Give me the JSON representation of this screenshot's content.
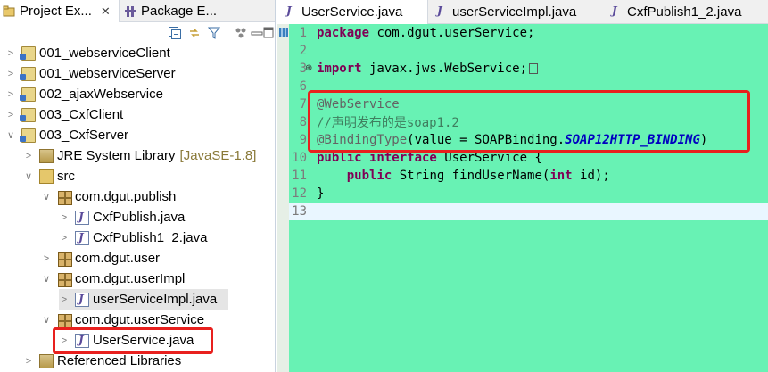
{
  "left_tabs": [
    {
      "label": "Project Ex...",
      "active": true,
      "icon": "project-explorer-icon"
    },
    {
      "label": "Package E...",
      "active": false,
      "icon": "package-explorer-icon"
    }
  ],
  "toolbar_icons": [
    "collapse-all-icon",
    "link-with-editor-icon",
    "filter-icon",
    "view-menu-icon",
    "minimize-icon",
    "maximize-icon"
  ],
  "tree": [
    {
      "label": "001_webserviceClient",
      "depth": 0,
      "expanded": false,
      "icon": "project-icon"
    },
    {
      "label": "001_webserviceServer",
      "depth": 0,
      "expanded": false,
      "icon": "project-icon"
    },
    {
      "label": "002_ajaxWebservice",
      "depth": 0,
      "expanded": false,
      "icon": "project-icon"
    },
    {
      "label": "003_CxfClient",
      "depth": 0,
      "expanded": false,
      "icon": "project-icon"
    },
    {
      "label": "003_CxfServer",
      "depth": 0,
      "expanded": true,
      "icon": "project-icon"
    },
    {
      "label": "JRE System Library",
      "suffix": "[JavaSE-1.8]",
      "depth": 1,
      "expanded": false,
      "icon": "library-icon"
    },
    {
      "label": "src",
      "depth": 1,
      "expanded": true,
      "icon": "source-folder-icon"
    },
    {
      "label": "com.dgut.publish",
      "depth": 2,
      "expanded": true,
      "icon": "package-icon"
    },
    {
      "label": "CxfPublish.java",
      "depth": 3,
      "expanded": false,
      "icon": "java-file-icon"
    },
    {
      "label": "CxfPublish1_2.java",
      "depth": 3,
      "expanded": false,
      "icon": "java-file-icon"
    },
    {
      "label": "com.dgut.user",
      "depth": 2,
      "expanded": false,
      "icon": "package-icon"
    },
    {
      "label": "com.dgut.userImpl",
      "depth": 2,
      "expanded": true,
      "icon": "package-icon"
    },
    {
      "label": "userServiceImpl.java",
      "depth": 3,
      "expanded": false,
      "icon": "java-file-icon",
      "selected": true
    },
    {
      "label": "com.dgut.userService",
      "depth": 2,
      "expanded": true,
      "icon": "package-icon"
    },
    {
      "label": "UserService.java",
      "depth": 3,
      "expanded": false,
      "icon": "java-interface-icon"
    },
    {
      "label": "Referenced Libraries",
      "depth": 1,
      "expanded": false,
      "icon": "library-icon"
    }
  ],
  "editor_tabs": [
    {
      "label": "UserService.java",
      "active": true
    },
    {
      "label": "userServiceImpl.java",
      "active": false
    },
    {
      "label": "CxfPublish1_2.java",
      "active": false
    }
  ],
  "code": {
    "line_numbers": [
      "1",
      "2",
      "3",
      "6",
      "7",
      "8",
      "9",
      "10",
      "11",
      "12",
      "13"
    ],
    "l1_kw": "package",
    "l1_rest": " com.dgut.userService;",
    "l3_kw": "import",
    "l3_rest": " javax.jws.WebService;",
    "l7": "@WebService",
    "l8": "//声明发布的是soap1.2",
    "l9_ann": "@BindingType",
    "l9_mid": "(value = SOAPBinding.",
    "l9_const": "SOAP12HTTP_BINDING",
    "l9_end": ")",
    "l10_kw": "public interface",
    "l10_rest": " UserService {",
    "l11_kw": "public",
    "l11_mid": " String findUserName(",
    "l11_kw2": "int",
    "l11_end": " id);",
    "l12": "}"
  },
  "colors": {
    "editor_background": "#68f2b4",
    "keyword": "#7f0055",
    "annotation": "#646464",
    "comment": "#3f7f5f",
    "constant": "#0000c0",
    "highlight_box": "#e8201e"
  }
}
